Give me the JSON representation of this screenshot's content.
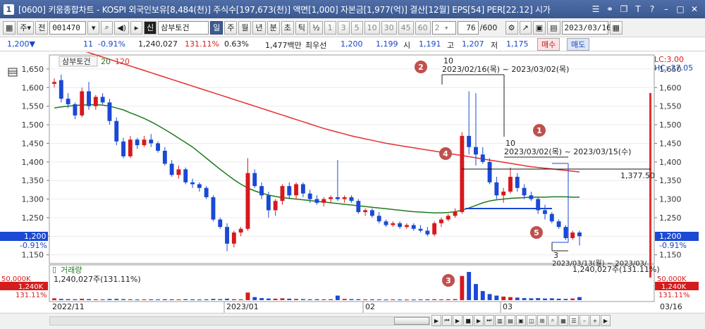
{
  "window": {
    "number": "1",
    "title": "[0600] 키움종합차트 - KOSPI 외국인보유[8,484(천)] 주식수[197,673(천)] 액면[1,000] 자본금[1,977(억)] 결산[12월] EPS[54] PER[22.12] 시가"
  },
  "toolbar": {
    "market": "주",
    "period_btn": "전",
    "code": "001470",
    "name_badge": "신",
    "stock_name": "삼부토건",
    "tf_day": "일",
    "tf_week": "주",
    "tf_month": "월",
    "tf_year": "년",
    "tf_minute": "분",
    "tf_second": "초",
    "tf_tick": "틱",
    "half": "½",
    "nums": [
      "1",
      "3",
      "5",
      "10",
      "30",
      "45",
      "60"
    ],
    "interval": "2",
    "count": "76",
    "total": "/600",
    "date": "2023/03/16"
  },
  "quote": {
    "price": "1,200▼",
    "change": "11",
    "change_pct": "-0.91%",
    "volume": "1,240,027",
    "vol_ratio": "131.11%",
    "turnover": "0.63%",
    "amount": "1,477백만",
    "best_label": "최우선",
    "ask": "1,200",
    "bid": "1,199",
    "open_label": "시",
    "open": "1,191",
    "high_label": "고",
    "high": "1,207",
    "low_label": "저",
    "low": "1,175",
    "buy": "매수",
    "sell": "매도"
  },
  "chart": {
    "legend_name": "삼부토건",
    "ma1_label": "20",
    "ma2_label": "120",
    "lc_label": "LC:3.00",
    "hc_label": "HC:-27.05",
    "y_ticks": [
      "1,650",
      "1,600",
      "1,550",
      "1,500",
      "1,450",
      "1,400",
      "1,350",
      "1,300",
      "1,250",
      "1,200",
      "1,150"
    ],
    "price_label": "1,200",
    "price_pct": "-0.91%",
    "level_label": "1,377.50",
    "annotation_1": "10",
    "annotation_1_range": "2023/02/16(목) ~ 2023/03/02(목)",
    "annotation_2": "10",
    "annotation_2_range": "2023/03/02(목) ~ 2023/03/15(수)",
    "annotation_3": "3",
    "annotation_3_range": "2023/03/13(월) ~ 2023/03/",
    "markers": [
      "1",
      "2",
      "3",
      "4",
      "5"
    ],
    "volume_title": "거래량",
    "volume_value": "1,240,027주(131.11%)",
    "volume_value_right": "1,240,027주(131.11%)",
    "vol_ticks": [
      "50,000K",
      "1,240K",
      "131.11%"
    ],
    "x_labels": [
      "2022/11",
      "2023/01",
      "02",
      "03",
      "03/16"
    ]
  },
  "colors": {
    "up": "#d7191c",
    "down": "#1a49d4",
    "ma20": "#1e7a1e",
    "ma120": "#e43030",
    "marker": "#c0504d"
  },
  "chart_data": {
    "type": "candlestick",
    "y_range": [
      1140,
      1665
    ],
    "dates": [
      "2022-11",
      "",
      "",
      "",
      "",
      "",
      "",
      "",
      "",
      "",
      "",
      "",
      "",
      "",
      "",
      "",
      "",
      "",
      "",
      "",
      "",
      "",
      "",
      "",
      "",
      "",
      "",
      "",
      "",
      "",
      "",
      "",
      "",
      "",
      "",
      "",
      "",
      "",
      "",
      "",
      "",
      "",
      "",
      "",
      "",
      "",
      "",
      "",
      "",
      "",
      "",
      "",
      "",
      "",
      "",
      "",
      "",
      "",
      "",
      "",
      "",
      "",
      "",
      "",
      "",
      "",
      "",
      "",
      "",
      "",
      "",
      "",
      "",
      "",
      "",
      "",
      "2023-03-16"
    ],
    "ohlc": [
      [
        1610,
        1625,
        1600,
        1615
      ],
      [
        1620,
        1635,
        1560,
        1570
      ],
      [
        1570,
        1585,
        1545,
        1555
      ],
      [
        1555,
        1560,
        1515,
        1525
      ],
      [
        1525,
        1600,
        1520,
        1590
      ],
      [
        1590,
        1615,
        1540,
        1550
      ],
      [
        1550,
        1580,
        1540,
        1575
      ],
      [
        1575,
        1585,
        1555,
        1560
      ],
      [
        1560,
        1570,
        1500,
        1510
      ],
      [
        1510,
        1520,
        1445,
        1455
      ],
      [
        1455,
        1465,
        1410,
        1415
      ],
      [
        1415,
        1470,
        1410,
        1460
      ],
      [
        1460,
        1465,
        1435,
        1445
      ],
      [
        1445,
        1470,
        1440,
        1460
      ],
      [
        1460,
        1475,
        1440,
        1450
      ],
      [
        1450,
        1455,
        1425,
        1430
      ],
      [
        1430,
        1440,
        1390,
        1395
      ],
      [
        1395,
        1405,
        1360,
        1365
      ],
      [
        1365,
        1390,
        1355,
        1380
      ],
      [
        1380,
        1385,
        1340,
        1345
      ],
      [
        1345,
        1355,
        1330,
        1340
      ],
      [
        1340,
        1345,
        1320,
        1330
      ],
      [
        1330,
        1335,
        1300,
        1305
      ],
      [
        1305,
        1310,
        1240,
        1245
      ],
      [
        1245,
        1250,
        1220,
        1225
      ],
      [
        1225,
        1235,
        1160,
        1180
      ],
      [
        1180,
        1215,
        1170,
        1210
      ],
      [
        1210,
        1225,
        1200,
        1220
      ],
      [
        1220,
        1410,
        1215,
        1370
      ],
      [
        1370,
        1380,
        1330,
        1335
      ],
      [
        1335,
        1345,
        1300,
        1310
      ],
      [
        1310,
        1320,
        1250,
        1270
      ],
      [
        1270,
        1300,
        1255,
        1295
      ],
      [
        1295,
        1340,
        1285,
        1335
      ],
      [
        1335,
        1345,
        1300,
        1310
      ],
      [
        1310,
        1345,
        1300,
        1340
      ],
      [
        1340,
        1345,
        1305,
        1315
      ],
      [
        1315,
        1325,
        1290,
        1300
      ],
      [
        1300,
        1310,
        1285,
        1290
      ],
      [
        1290,
        1305,
        1280,
        1300
      ],
      [
        1300,
        1310,
        1290,
        1305
      ],
      [
        1305,
        1405,
        1295,
        1300
      ],
      [
        1300,
        1310,
        1290,
        1305
      ],
      [
        1305,
        1310,
        1290,
        1295
      ],
      [
        1295,
        1300,
        1260,
        1265
      ],
      [
        1265,
        1275,
        1255,
        1270
      ],
      [
        1270,
        1275,
        1250,
        1255
      ],
      [
        1255,
        1265,
        1235,
        1240
      ],
      [
        1240,
        1245,
        1225,
        1230
      ],
      [
        1230,
        1240,
        1225,
        1235
      ],
      [
        1235,
        1240,
        1220,
        1225
      ],
      [
        1225,
        1235,
        1220,
        1230
      ],
      [
        1230,
        1235,
        1215,
        1220
      ],
      [
        1220,
        1230,
        1210,
        1215
      ],
      [
        1215,
        1225,
        1200,
        1205
      ],
      [
        1205,
        1240,
        1200,
        1235
      ],
      [
        1235,
        1250,
        1225,
        1245
      ],
      [
        1245,
        1260,
        1240,
        1255
      ],
      [
        1255,
        1275,
        1250,
        1265
      ],
      [
        1265,
        1480,
        1260,
        1470
      ],
      [
        1470,
        1590,
        1420,
        1440
      ],
      [
        1440,
        1585,
        1390,
        1420
      ],
      [
        1420,
        1440,
        1395,
        1400
      ],
      [
        1400,
        1410,
        1340,
        1345
      ],
      [
        1345,
        1360,
        1300,
        1310
      ],
      [
        1310,
        1330,
        1290,
        1320
      ],
      [
        1320,
        1385,
        1315,
        1360
      ],
      [
        1360,
        1370,
        1320,
        1330
      ],
      [
        1330,
        1340,
        1300,
        1310
      ],
      [
        1310,
        1320,
        1295,
        1300
      ],
      [
        1300,
        1305,
        1260,
        1270
      ],
      [
        1270,
        1285,
        1245,
        1260
      ],
      [
        1260,
        1265,
        1235,
        1240
      ],
      [
        1240,
        1245,
        1220,
        1225
      ],
      [
        1225,
        1230,
        1190,
        1195
      ],
      [
        1195,
        1215,
        1190,
        1210
      ],
      [
        1210,
        1215,
        1175,
        1200
      ]
    ],
    "ma20": [
      1545,
      1548,
      1550,
      1552,
      1553,
      1554,
      1554,
      1553,
      1550,
      1545,
      1540,
      1532,
      1525,
      1517,
      1508,
      1498,
      1487,
      1476,
      1464,
      1452,
      1440,
      1425,
      1410,
      1395,
      1380,
      1366,
      1352,
      1340,
      1330,
      1322,
      1316,
      1311,
      1307,
      1304,
      1302,
      1300,
      1298,
      1296,
      1294,
      1292,
      1290,
      1288,
      1286,
      1284,
      1282,
      1280,
      1278,
      1276,
      1274,
      1272,
      1270,
      1268,
      1266,
      1265,
      1264,
      1263,
      1263,
      1264,
      1266,
      1270,
      1276,
      1283,
      1290,
      1295,
      1298,
      1300,
      1302,
      1303,
      1304,
      1305,
      1305,
      1305,
      1306,
      1306,
      1306,
      1305,
      1305
    ],
    "ma120": [
      1720,
      1715,
      1710,
      1705,
      1700,
      1694,
      1688,
      1682,
      1676,
      1670,
      1664,
      1658,
      1652,
      1646,
      1640,
      1634,
      1628,
      1622,
      1616,
      1610,
      1604,
      1598,
      1592,
      1586,
      1580,
      1574,
      1568,
      1562,
      1556,
      1550,
      1544,
      1538,
      1532,
      1526,
      1520,
      1514,
      1508,
      1502,
      1496,
      1490,
      1485,
      1480,
      1475,
      1470,
      1466,
      1462,
      1458,
      1454,
      1450,
      1447,
      1444,
      1441,
      1438,
      1435,
      1432,
      1429,
      1426,
      1423,
      1420,
      1417,
      1414,
      1411,
      1408,
      1405,
      1402,
      1399,
      1396,
      1393,
      1390,
      1387,
      1385,
      1383,
      1381,
      1379,
      1377,
      1375,
      1373
    ],
    "volume": [
      18,
      12,
      10,
      9,
      14,
      10,
      8,
      7,
      11,
      12,
      10,
      8,
      6,
      7,
      8,
      7,
      9,
      8,
      7,
      9,
      8,
      6,
      8,
      12,
      10,
      14,
      9,
      8,
      75,
      30,
      20,
      16,
      14,
      18,
      14,
      12,
      10,
      8,
      9,
      8,
      9,
      45,
      12,
      10,
      9,
      7,
      8,
      7,
      6,
      7,
      6,
      6,
      6,
      7,
      8,
      9,
      8,
      9,
      10,
      240,
      280,
      160,
      90,
      60,
      45,
      35,
      30,
      25,
      20,
      18,
      20,
      16,
      18,
      14,
      12,
      16,
      30
    ]
  }
}
